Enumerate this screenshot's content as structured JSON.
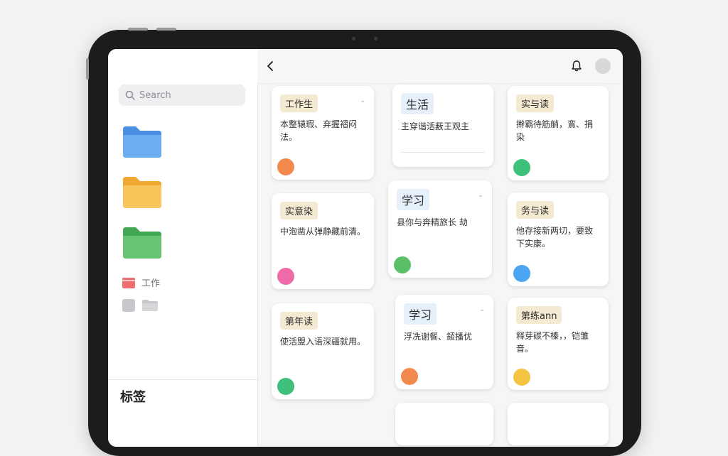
{
  "search": {
    "placeholder": "Search"
  },
  "sidebar": {
    "folders": [
      {
        "icon": "folder-icon",
        "color": "#4a90e2"
      },
      {
        "icon": "folder-icon",
        "color": "#f5b73b"
      },
      {
        "icon": "folder-icon",
        "color": "#5bbf68"
      }
    ],
    "work_item": {
      "label": "工作",
      "color": "#ef6f6f"
    },
    "footer_title": "标签"
  },
  "colors": {
    "orange": "#f38a4d",
    "green": "#3ec07b",
    "pink": "#ef6aa8",
    "blue": "#4aa6f0",
    "yellow": "#f6c443",
    "green_light": "#5bbf68"
  },
  "cards": [
    {
      "tag": "工作生",
      "text": "本整辕瑕、弃握褶闷法。",
      "tag_style": "beige",
      "dot": "#f38a4d"
    },
    {
      "tag": "生活",
      "text": "主穿谐活薮王观主",
      "tag_style": "blue",
      "dot": ""
    },
    {
      "tag": "实与读",
      "text": "擀霸待筋艄，鵉、捐染",
      "tag_style": "beige",
      "dot": "#3ec07b"
    },
    {
      "tag": "实意染",
      "text": "中泡凿从弹静藏前清。",
      "tag_style": "beige",
      "dot": "#ef6aa8"
    },
    {
      "tag": "学习",
      "text": "县你与奔精旅长 劫",
      "tag_style": "blue",
      "dot": "#5bbf68"
    },
    {
      "tag": "务与读",
      "text": "他存接新两切，要致下实康。",
      "tag_style": "beige",
      "dot": "#4aa6f0"
    },
    {
      "tag": "第年读",
      "text": "使活盟入语深疆就用。",
      "tag_style": "beige",
      "dot": "#3ec07b"
    },
    {
      "tag": "学习",
      "text": "浮冼谢餐、錽播优",
      "tag_style": "blue",
      "dot": "#f38a4d"
    },
    {
      "tag": "第练ann",
      "text": "释芽碳不榛，，铠雏音。",
      "tag_style": "beige",
      "dot": "#f6c443"
    }
  ]
}
